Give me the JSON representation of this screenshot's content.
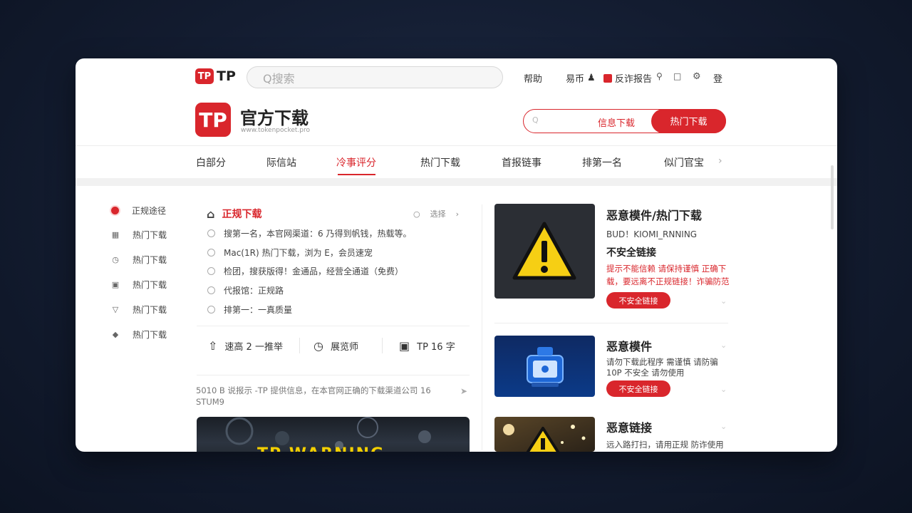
{
  "header": {
    "logo_badge": "TP",
    "logo_text": "TP",
    "search_placeholder": "Q搜索",
    "nav": [
      "帮助",
      "易币",
      "反诈报告",
      "登"
    ]
  },
  "brand": {
    "logo": "TP",
    "title": "官方下载",
    "subtitle": "www.tokenpocket.pro"
  },
  "quick_search": {
    "placeholder": "Q",
    "secondary_label": "信息下载",
    "primary_label": "热门下载"
  },
  "tabs": [
    {
      "label": "白部分",
      "active": false
    },
    {
      "label": "际信站",
      "active": false
    },
    {
      "label": "冷事评分",
      "active": true
    },
    {
      "label": "热门下载",
      "active": false
    },
    {
      "label": "首报链事",
      "active": false
    },
    {
      "label": "排第一名",
      "active": false,
      "highlight": true
    },
    {
      "label": "似门官宝",
      "active": false
    }
  ],
  "sidebar": {
    "items": [
      {
        "label": "正规途径",
        "icon": "red-dot-icon"
      },
      {
        "label": "热门下载",
        "icon": "calendar-icon"
      },
      {
        "label": "热门下载",
        "icon": "clock-icon"
      },
      {
        "label": "热门下载",
        "icon": "bag-icon"
      },
      {
        "label": "热门下载",
        "icon": "shield-icon"
      },
      {
        "label": "热门下载",
        "icon": "diamond-icon"
      }
    ]
  },
  "notice": {
    "title": "正规下载",
    "more_label": "选择",
    "items": [
      "搜第一名，本官网渠道：6 乃得到帆钱，热载等。",
      "Mac(1R) 热门下载，浏为 E，会员速宠",
      "检团，搜获版得！金通品，经营全通道（免费）",
      "代报馆：正规路",
      "排第一：一真质量"
    ]
  },
  "tools": [
    {
      "label": "速高 2 一推举",
      "icon": "share-icon"
    },
    {
      "label": "展览师",
      "icon": "clock-icon"
    },
    {
      "label": "TP 16 字",
      "icon": "scan-icon"
    }
  ],
  "news": {
    "text": "5010 B 说报示 -TP 提供信息，在本官网正确的下载渠道公司 16 STUM9"
  },
  "banner": {
    "text": "TP WARNING"
  },
  "cards": [
    {
      "title": "恶意模件/热门下载",
      "line1": "BUD！KIOMI_RNNING",
      "warning": "不安全链接",
      "desc": "提示不能信赖 请保持谨慎 正确下载，要远离不正规链接！诈骗防范",
      "button": "不安全链接"
    },
    {
      "title": "恶意模件",
      "desc": "请勿下载此程序 需谨慎 请防骗 10P 不安全 请勿使用",
      "button": "不安全链接"
    },
    {
      "title": "恶意链接",
      "desc": "远入路打扫，请用正规 防诈使用"
    }
  ],
  "colors": {
    "accent": "#d9262c",
    "window_bg": "#ffffff",
    "page_bg": "#131c30"
  }
}
